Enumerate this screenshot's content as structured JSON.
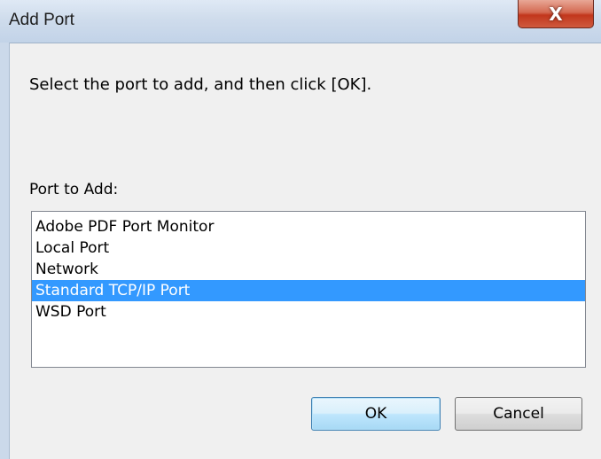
{
  "window": {
    "title": "Add Port",
    "close_glyph": "X"
  },
  "dialog": {
    "instruction": "Select the port to add, and then click [OK].",
    "port_label": "Port to Add:",
    "ports": [
      "Adobe PDF Port Monitor",
      "Local Port",
      "Network",
      "Standard TCP/IP Port",
      "WSD Port"
    ],
    "selected_index": 3
  },
  "buttons": {
    "ok": "OK",
    "cancel": "Cancel"
  },
  "colors": {
    "selection": "#3399ff",
    "close_button": "#c2371d"
  }
}
